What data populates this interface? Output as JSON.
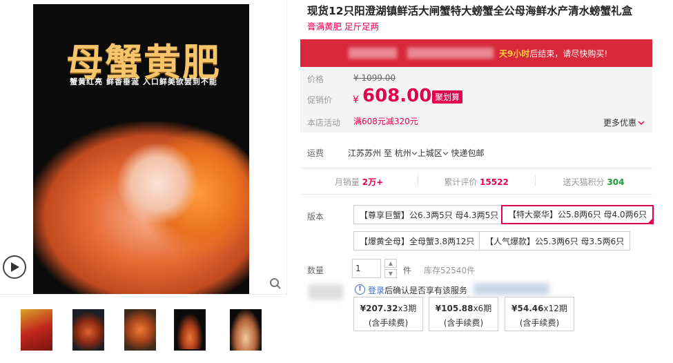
{
  "gallery": {
    "main_title_art": "母蟹黄肥",
    "main_subtitle_art": "蟹黄红亮  鲜香垂涎  入口鲜美欲罢到不能",
    "thumb_count": 5,
    "selected_thumb": 4
  },
  "product": {
    "title": "现货12只阳澄湖镇鲜活大闸蟹特大螃蟹全公母海鲜水产清水螃蟹礼盒",
    "subtitle": "膏满黄肥 足斤足两"
  },
  "promo": {
    "message_prefix": "",
    "message_highlight": "天9小时",
    "message_suffix": "后结束，请尽快购买!"
  },
  "price": {
    "label_price": "价格",
    "original": "¥ 1099.00",
    "label_promo": "促销价",
    "currency": "¥",
    "current": "608.00",
    "badge": "聚划算",
    "label_activity": "本店活动",
    "activity": "满608元减320元",
    "more": "更多优惠"
  },
  "shipping": {
    "label": "运费",
    "from": "江苏苏州",
    "to_word": "至",
    "city": "杭州",
    "district": "上城区",
    "note": "快递包邮"
  },
  "stats": {
    "monthly_label": "月销量",
    "monthly_value": "2万+",
    "reviews_label": "累计评价",
    "reviews_value": "15522",
    "points_label": "送天猫积分",
    "points_value": "304"
  },
  "versions": {
    "label": "版本",
    "options": [
      "【尊享巨蟹】公6.3两5只 母4.3两5只",
      "【特大豪华】公5.8两6只 母4.0两6只",
      "【爆黄全母】全母蟹3.8两12只",
      "【人气爆款】公5.3两6只 母3.5两6只"
    ],
    "selected_index": 1
  },
  "quantity": {
    "label": "数量",
    "value": "1",
    "unit": "件",
    "stock": "库存52540件"
  },
  "notice": {
    "link": "登录",
    "text": "后确认是否享有该服务"
  },
  "installments": [
    {
      "amount": "¥207.32",
      "periods": "x3期",
      "fee": "(含手续费)"
    },
    {
      "amount": "¥105.88",
      "periods": "x6期",
      "fee": "(含手续费)"
    },
    {
      "amount": "¥54.46",
      "periods": "x12期",
      "fee": "(含手续费)"
    }
  ],
  "colors": {
    "accent": "#e5004f",
    "promo_bar": "#d8293a",
    "points": "#1f9b3a",
    "link": "#3b6ed6"
  }
}
